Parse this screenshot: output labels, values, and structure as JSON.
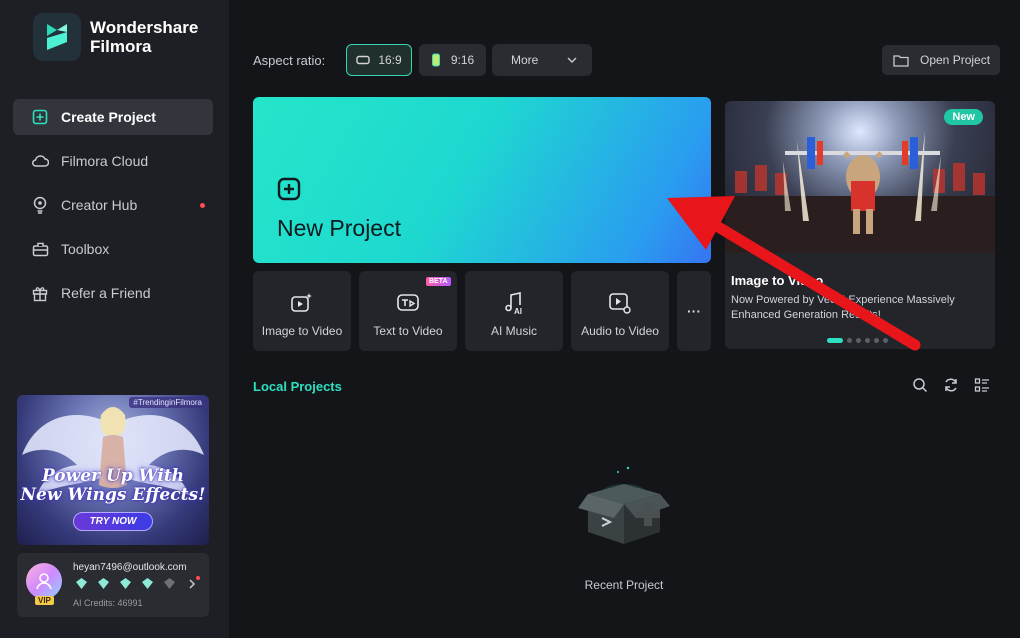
{
  "app": {
    "name_line1": "Wondershare",
    "name_line2": "Filmora"
  },
  "sidebar": {
    "items": [
      {
        "label": "Create Project",
        "icon": "plus-square-icon",
        "active": true
      },
      {
        "label": "Filmora Cloud",
        "icon": "cloud-icon"
      },
      {
        "label": "Creator Hub",
        "icon": "bulb-icon",
        "notification": true
      },
      {
        "label": "Toolbox",
        "icon": "toolbox-icon"
      },
      {
        "label": "Refer a Friend",
        "icon": "gift-icon"
      }
    ],
    "promo": {
      "tag": "#TrendinginFilmora",
      "title_line1": "Power Up With",
      "title_line2": "New Wings Effects!",
      "button": "TRY NOW"
    },
    "account": {
      "email": "heyan7496@outlook.com",
      "badge": "VIP",
      "credits": "AI Credits: 46991"
    }
  },
  "toolbar": {
    "aspect_label": "Aspect ratio:",
    "ratio_169": "16:9",
    "ratio_916": "9:16",
    "more": "More",
    "open_project": "Open Project"
  },
  "new_project": {
    "label": "New Project"
  },
  "tools": [
    {
      "label": "Image to Video",
      "icon": "image-to-video-icon"
    },
    {
      "label": "Text to Video",
      "icon": "text-to-video-icon",
      "badge": "BETA"
    },
    {
      "label": "AI Music",
      "icon": "ai-music-icon"
    },
    {
      "label": "Audio to Video",
      "icon": "audio-to-video-icon"
    }
  ],
  "tools_more": "···",
  "feature": {
    "badge": "New",
    "title": "Image to Video",
    "description": "Now Powered by Veo3! Experience Massively Enhanced Generation Results!",
    "slides": 6,
    "current_slide": 1
  },
  "local_projects": {
    "title": "Local Projects",
    "empty_label": "Recent Project"
  },
  "colors": {
    "accent": "#2de0c0",
    "sidebar_bg": "#1e1f24",
    "main_bg": "#141519",
    "annotation_arrow": "#e8151b"
  }
}
